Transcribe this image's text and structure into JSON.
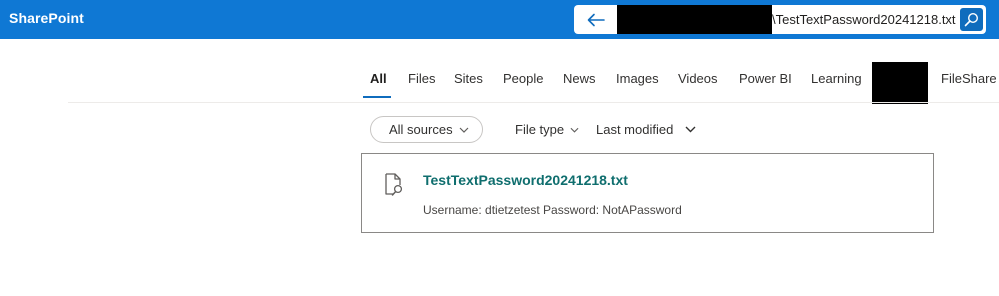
{
  "app": {
    "title": "SharePoint"
  },
  "search": {
    "query_visible": "\\TestTextPassword20241218.txt"
  },
  "tabs": [
    {
      "label": "All",
      "active": true
    },
    {
      "label": "Files"
    },
    {
      "label": "Sites"
    },
    {
      "label": "People"
    },
    {
      "label": "News"
    },
    {
      "label": "Images"
    },
    {
      "label": "Videos"
    },
    {
      "label": "Power BI"
    },
    {
      "label": "Learning"
    },
    {
      "label": "FileShare"
    }
  ],
  "filters": {
    "sources_label": "All sources",
    "file_type_label": "File type",
    "last_modified_label": "Last modified"
  },
  "results": [
    {
      "title": "TestTextPassword20241218.txt",
      "snippet": "Username: dtietzetest Password: NotAPassword",
      "icon": "document-search-icon"
    }
  ],
  "colors": {
    "topbar": "#0f78d4",
    "accent": "#0f6cbd",
    "result_title": "#0f6e6e"
  }
}
